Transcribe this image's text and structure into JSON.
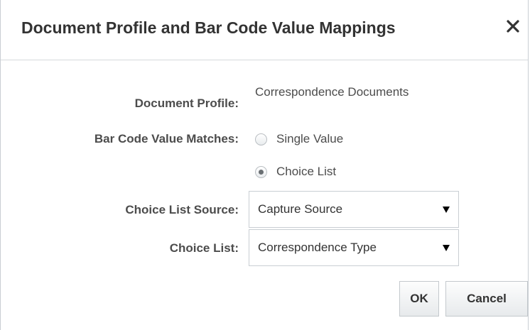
{
  "dialog": {
    "title": "Document Profile and Bar Code Value Mappings",
    "close_icon": "close-icon"
  },
  "form": {
    "document_profile": {
      "label": "Document Profile:",
      "value": "Correspondence Documents"
    },
    "bar_code_value_matches": {
      "label": "Bar Code Value Matches:",
      "options": [
        {
          "label": "Single Value",
          "selected": false
        },
        {
          "label": "Choice List",
          "selected": true
        }
      ]
    },
    "choice_list_source": {
      "label": "Choice List Source:",
      "selected": "Capture Source"
    },
    "choice_list": {
      "label": "Choice List:",
      "selected": "Correspondence Type"
    }
  },
  "buttons": {
    "ok": "OK",
    "cancel": "Cancel"
  },
  "colors": {
    "text": "#333333",
    "label": "#4c4c4c",
    "border": "#c9ced3"
  }
}
